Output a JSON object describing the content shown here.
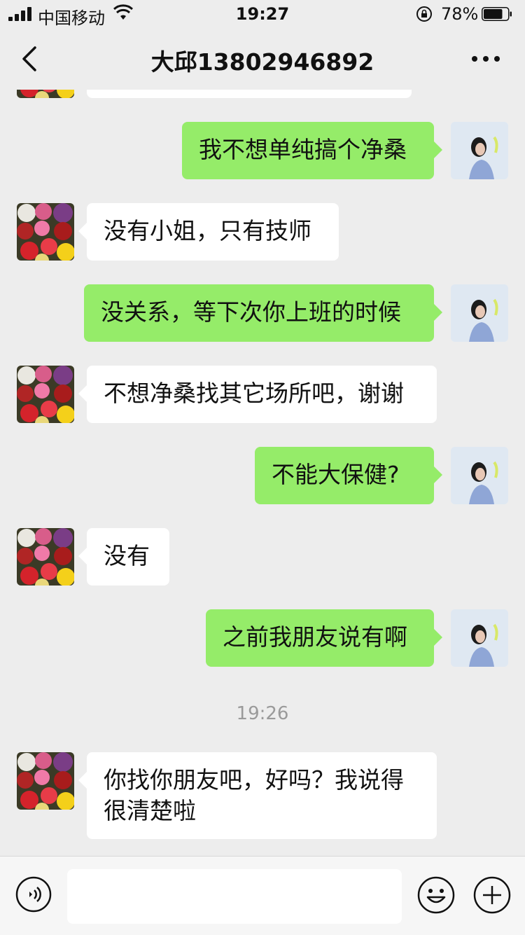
{
  "status_bar": {
    "carrier": "中国移动",
    "time": "19:27",
    "battery_percent": "78%",
    "battery_level": 0.78,
    "icons": [
      "signal-icon",
      "wifi-icon",
      "rotation-lock-icon",
      "battery-icon"
    ]
  },
  "nav": {
    "title": "大邱13802946892",
    "icons": [
      "back-chevron-icon",
      "more-dots-icon"
    ]
  },
  "messages": [
    {
      "from": "me",
      "text": "我不想单纯搞个净桑"
    },
    {
      "from": "contact",
      "text": "没有小姐，只有技师"
    },
    {
      "from": "me",
      "text": "没关系，等下次你上班的时候"
    },
    {
      "from": "contact",
      "text": "不想净桑找其它场所吧，谢谢"
    },
    {
      "from": "me",
      "text": "不能大保健?"
    },
    {
      "from": "contact",
      "text": "没有"
    },
    {
      "from": "me",
      "text": "之前我朋友说有啊"
    },
    {
      "from": "contact",
      "text": "你找你朋友吧，好吗？我说得很清楚啦"
    }
  ],
  "timestamp": "19:26",
  "input_bar": {
    "placeholder": "",
    "icons": [
      "voice-icon",
      "emoji-icon",
      "plus-icon"
    ]
  },
  "colors": {
    "background": "#ededed",
    "outgoing_bubble": "#95ec69",
    "incoming_bubble": "#ffffff",
    "timestamp_text": "#9a9a9a"
  }
}
